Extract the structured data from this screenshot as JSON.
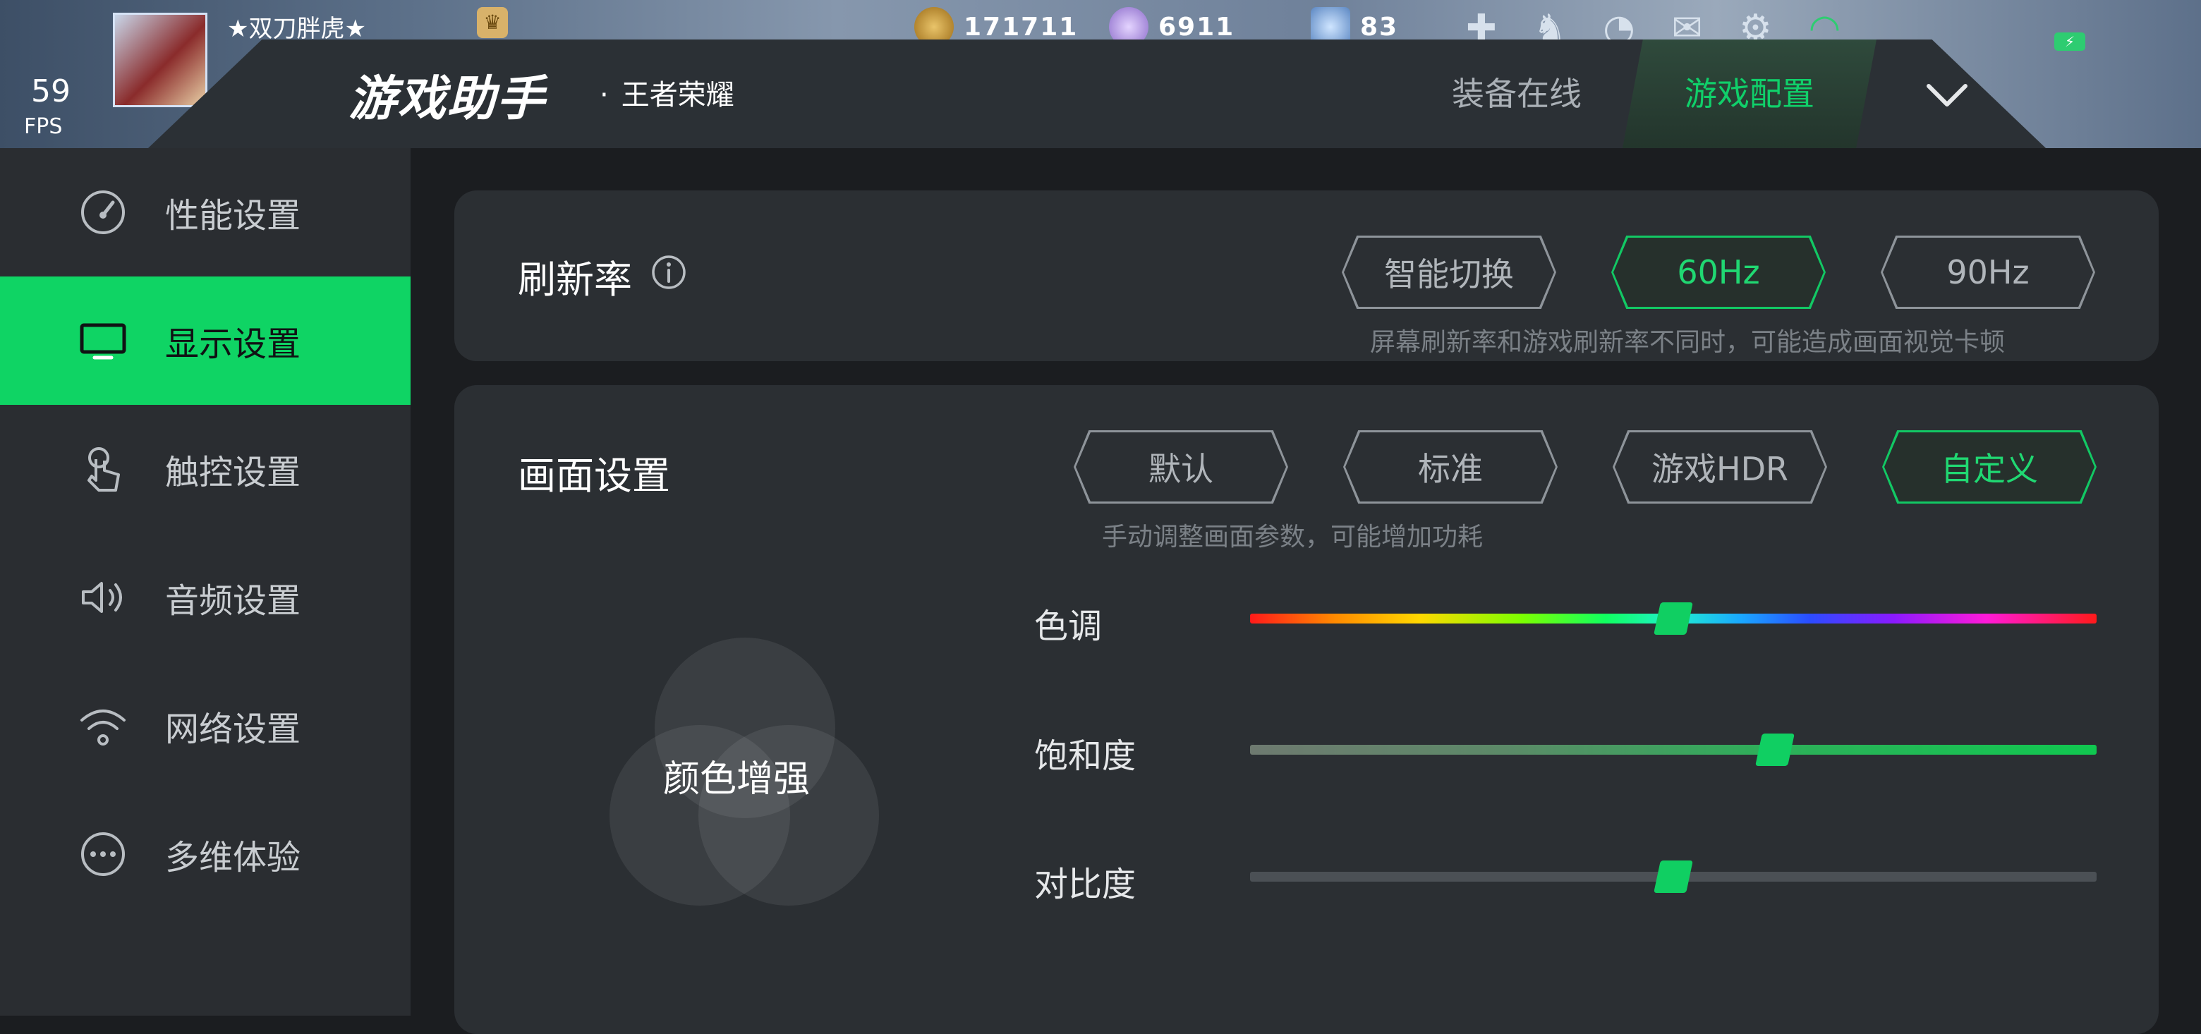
{
  "game_hud": {
    "player_name": "★双刀胖虎★",
    "fps_value": "59",
    "fps_unit": "FPS",
    "resources": [
      {
        "name": "gold",
        "value": "171711"
      },
      {
        "name": "gem",
        "value": "6911"
      },
      {
        "name": "ticket",
        "value": "83"
      }
    ],
    "status_icons": [
      "upgrade-icon",
      "bell-icon",
      "signal-icon",
      "mail-icon",
      "gear-icon",
      "wifi-icon",
      "battery-icon"
    ]
  },
  "header": {
    "logo": "游戏助手",
    "game_name": "王者荣耀",
    "separator": "·",
    "tabs": [
      {
        "label": "装备在线",
        "active": false
      },
      {
        "label": "游戏配置",
        "active": true
      }
    ],
    "expand_icon": "chevron-down-icon"
  },
  "sidebar": {
    "items": [
      {
        "label": "性能设置",
        "icon": "speedometer-icon",
        "active": false
      },
      {
        "label": "显示设置",
        "icon": "monitor-icon",
        "active": true
      },
      {
        "label": "触控设置",
        "icon": "touch-hand-icon",
        "active": false
      },
      {
        "label": "音频设置",
        "icon": "speaker-icon",
        "active": false
      },
      {
        "label": "网络设置",
        "icon": "wifi-icon",
        "active": false
      },
      {
        "label": "多维体验",
        "icon": "more-icon",
        "active": false
      }
    ]
  },
  "refresh_rate": {
    "title": "刷新率",
    "options": [
      {
        "label": "智能切换",
        "selected": false
      },
      {
        "label": "60Hz",
        "selected": true
      },
      {
        "label": "90Hz",
        "selected": false
      }
    ],
    "hint": "屏幕刷新率和游戏刷新率不同时，可能造成画面视觉卡顿"
  },
  "display": {
    "title": "画面设置",
    "options": [
      {
        "label": "默认",
        "selected": false
      },
      {
        "label": "标准",
        "selected": false
      },
      {
        "label": "游戏HDR",
        "selected": false
      },
      {
        "label": "自定义",
        "selected": true
      }
    ],
    "hint": "手动调整画面参数，可能增加功耗",
    "enhance_label": "颜色增强",
    "sliders": [
      {
        "label": "色调",
        "value": 0.5
      },
      {
        "label": "饱和度",
        "value": 0.62
      },
      {
        "label": "对比度",
        "value": 0.5
      }
    ]
  },
  "colors": {
    "accent": "#0fd464",
    "panel": "#2b2f33",
    "sidebar": "#2a2d31",
    "background": "#1b1d20"
  }
}
